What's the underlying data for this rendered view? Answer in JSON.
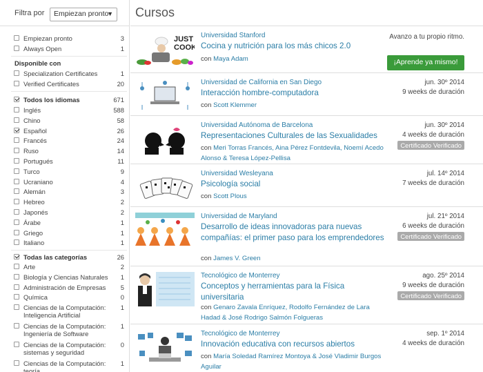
{
  "filter": {
    "label": "Filtra por",
    "selected": "Empiezan pronto"
  },
  "filters": {
    "availability": [
      {
        "label": "Empiezan pronto",
        "count": "3"
      },
      {
        "label": "Always Open",
        "count": "1"
      }
    ],
    "disponible_title": "Disponible con",
    "certificates": [
      {
        "label": "Specialization Certificates",
        "count": "1"
      },
      {
        "label": "Verified Certificates",
        "count": "20"
      }
    ],
    "languages_all": {
      "label": "Todos los idiomas",
      "count": "671"
    },
    "languages": [
      {
        "label": "Inglés",
        "count": "588"
      },
      {
        "label": "Chino",
        "count": "58"
      },
      {
        "label": "Español",
        "count": "26"
      },
      {
        "label": "Francés",
        "count": "24"
      },
      {
        "label": "Ruso",
        "count": "14"
      },
      {
        "label": "Portugués",
        "count": "11"
      },
      {
        "label": "Turco",
        "count": "9"
      },
      {
        "label": "Ucraniano",
        "count": "4"
      },
      {
        "label": "Alemán",
        "count": "3"
      },
      {
        "label": "Hebreo",
        "count": "2"
      },
      {
        "label": "Japonés",
        "count": "2"
      },
      {
        "label": "Árabe",
        "count": "1"
      },
      {
        "label": "Griego",
        "count": "1"
      },
      {
        "label": "Italiano",
        "count": "1"
      }
    ],
    "categories_all": {
      "label": "Todas las categorías",
      "count": "26"
    },
    "categories": [
      {
        "label": "Arte",
        "count": "2"
      },
      {
        "label": "Biología y Ciencias Naturales",
        "count": "1"
      },
      {
        "label": "Administración de Empresas",
        "count": "5"
      },
      {
        "label": "Química",
        "count": "0"
      },
      {
        "label": "Ciencias de la Computación:",
        "label2": "Inteligencia Artificial",
        "count": "1"
      },
      {
        "label": "Ciencias de la Computación:",
        "label2": "Ingeniería de Software",
        "count": "1"
      },
      {
        "label": "Ciencias de la Computación:",
        "label2": "sistemas y seguridad",
        "count": "0"
      },
      {
        "label": "Ciencias de la Computación:",
        "label2": "teoría",
        "count": "1"
      }
    ]
  },
  "main": {
    "title": "Cursos",
    "courses": [
      {
        "university": "Universidad Stanford",
        "title": "Cocina y nutrición para los más chicos 2.0",
        "con": "con",
        "instructors": "Maya Adam",
        "availability": "Avanzo a tu propio ritmo.",
        "enroll": "¡Aprende ya mismo!",
        "thumb_text1": "JUST",
        "thumb_text2": "COOK"
      },
      {
        "university": "Universidad de California en San Diego",
        "title": "Interacción hombre-computadora",
        "con": "con",
        "instructors": "Scott Klemmer",
        "date": "jun. 30º 2014",
        "duration": "9 weeks de duración"
      },
      {
        "university": "Universidad Autónoma de Barcelona",
        "title": "Representaciones Culturales de las Sexualidades",
        "con": "con",
        "instructors": "Meri Torras Francés, Aina Pérez Fontdevila, Noemí Acedo Alonso & Teresa López-Pellisa",
        "date": "jun. 30º 2014",
        "duration": "4 weeks de duración",
        "cert": "Certificado Verificado"
      },
      {
        "university": "Universidad Wesleyana",
        "title": "Psicología social",
        "con": "con",
        "instructors": "Scott Plous",
        "date": "jul. 14º 2014",
        "duration": "7 weeks de duración"
      },
      {
        "university": "Universidad de Maryland",
        "title": "Desarrollo de ideas innovadoras para nuevas compañías: el primer paso para los emprendedores",
        "con": "con",
        "instructors": "James V. Green",
        "date": "jul. 21º 2014",
        "duration": "6 weeks de duración",
        "cert": "Certificado Verificado"
      },
      {
        "university": "Tecnológico de Monterrey",
        "title": "Conceptos y herramientas para la Física universitaria",
        "con": "con",
        "instructors": "Genaro Zavala Enríquez, Rodolfo Fernández de Lara Hadad & José Rodrigo Salmón Folgueras",
        "date": "ago. 25º 2014",
        "duration": "9 weeks de duración",
        "cert": "Certificado Verificado"
      },
      {
        "university": "Tecnológico de Monterrey",
        "title": "Innovación educativa con recursos abiertos",
        "con": "con",
        "instructors": "María Soledad Ramírez Montoya & José Vladimir Burgos Aguilar",
        "date": "sep. 1º 2014",
        "duration": "4 weeks de duración"
      }
    ]
  },
  "colors": {
    "link": "#2a7da6",
    "enroll": "#3a9b3a",
    "cert": "#aaaaaa"
  }
}
